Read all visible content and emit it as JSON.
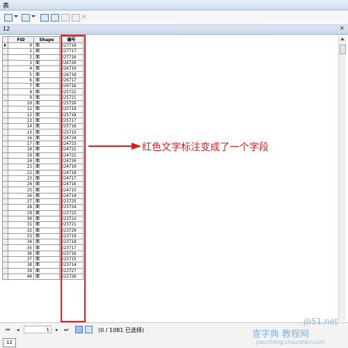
{
  "window": {
    "title": "表"
  },
  "toolbar": {
    "buttons": [
      "table-options-icon",
      "related-tables-icon",
      "select-by-attributes-icon",
      "switch-selection-icon",
      "clear-selection-icon",
      "zoom-to-selected-icon",
      "delete-icon"
    ]
  },
  "tab": {
    "name": "12",
    "close": "×"
  },
  "table": {
    "columns": [
      "FID",
      "Shape",
      "编号"
    ],
    "rows": [
      [
        "0",
        "面",
        "227718"
      ],
      [
        "1",
        "面",
        "227717"
      ],
      [
        "2",
        "面",
        "227716"
      ],
      [
        "3",
        "面",
        "226720"
      ],
      [
        "4",
        "面",
        "226719"
      ],
      [
        "5",
        "面",
        "226718"
      ],
      [
        "6",
        "面",
        "226717"
      ],
      [
        "7",
        "面",
        "226716"
      ],
      [
        "8",
        "面",
        "225722"
      ],
      [
        "9",
        "面",
        "225721"
      ],
      [
        "10",
        "面",
        "225720"
      ],
      [
        "11",
        "面",
        "225719"
      ],
      [
        "12",
        "面",
        "225718"
      ],
      [
        "13",
        "面",
        "225717"
      ],
      [
        "14",
        "面",
        "225716"
      ],
      [
        "15",
        "面",
        "225715"
      ],
      [
        "16",
        "面",
        "224724"
      ],
      [
        "17",
        "面",
        "224723"
      ],
      [
        "18",
        "面",
        "224722"
      ],
      [
        "19",
        "面",
        "224721"
      ],
      [
        "20",
        "面",
        "224720"
      ],
      [
        "21",
        "面",
        "224719"
      ],
      [
        "22",
        "面",
        "224718"
      ],
      [
        "23",
        "面",
        "224717"
      ],
      [
        "24",
        "面",
        "224716"
      ],
      [
        "25",
        "面",
        "224715"
      ],
      [
        "26",
        "面",
        "224714"
      ],
      [
        "27",
        "面",
        "223725"
      ],
      [
        "28",
        "面",
        "223724"
      ],
      [
        "29",
        "面",
        "223723"
      ],
      [
        "30",
        "面",
        "223722"
      ],
      [
        "31",
        "面",
        "223721"
      ],
      [
        "32",
        "面",
        "223720"
      ],
      [
        "33",
        "面",
        "223719"
      ],
      [
        "34",
        "面",
        "223718"
      ],
      [
        "35",
        "面",
        "223717"
      ],
      [
        "36",
        "面",
        "223716"
      ],
      [
        "37",
        "面",
        "223715"
      ],
      [
        "38",
        "面",
        "223714"
      ],
      [
        "39",
        "面",
        "222727"
      ],
      [
        "40",
        "面",
        "222726"
      ]
    ],
    "highlight_color": "#e02020"
  },
  "annotation": {
    "text": "红色文字标注变成了一个字段",
    "color": "#e01818"
  },
  "statusbar": {
    "first": "⏮",
    "prev": "◂",
    "page": "1",
    "next": "▸",
    "last": "⏭",
    "selection": "(0 / 1081 已选择)"
  },
  "bottom_tab": "12",
  "watermark": {
    "site": "jb51.net",
    "cn": "查字典 教程网",
    "url": "jiaocheng.chazidian.com"
  }
}
